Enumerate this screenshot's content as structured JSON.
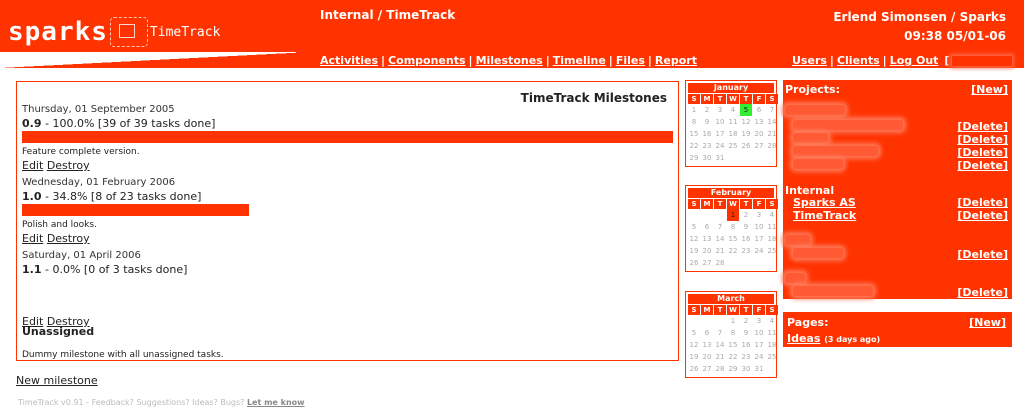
{
  "header": {
    "logo_word": "sparks",
    "logo_sub": "TimeTrack",
    "breadcrumb": "Internal / TimeTrack",
    "user": "Erlend Simonsen / Sparks",
    "clock": "09:38 05/01-06",
    "nav_left": [
      "Activities",
      "Components",
      "Milestones",
      "Timeline",
      "Files",
      "Report"
    ],
    "nav_right": [
      "Users",
      "Clients",
      "Log Out"
    ],
    "bracket_open": "["
  },
  "milestones": {
    "title": "TimeTrack Milestones",
    "items": [
      {
        "date": "Thursday, 01 September 2005",
        "version": "0.9",
        "stats": " - 100.0% [39 of 39 tasks done]",
        "progress": 1.0,
        "desc": "Feature complete version.",
        "edit": "Edit",
        "destroy": "Destroy"
      },
      {
        "date": "Wednesday, 01 February 2006",
        "version": "1.0",
        "stats": " - 34.8% [8 of 23 tasks done]",
        "progress": 0.348,
        "desc": "Polish and looks.",
        "edit": "Edit",
        "destroy": "Destroy"
      },
      {
        "date": "Saturday, 01 April 2006",
        "version": "1.1",
        "stats": " - 0.0% [0 of 3 tasks done]",
        "progress": 0.0,
        "desc": "",
        "edit": "Edit",
        "destroy": "Destroy"
      }
    ],
    "unassigned": "Unassigned",
    "unassigned_desc": "Dummy milestone with all unassigned tasks.",
    "new_link": "New milestone"
  },
  "footer": {
    "text": "TimeTrack v0.91 - Feedback? Suggestions? Ideas? Bugs? ",
    "link": "Let me know"
  },
  "calendars": {
    "day_headers": [
      "S",
      "M",
      "T",
      "W",
      "T",
      "F",
      "S"
    ],
    "months": [
      {
        "name": "January",
        "lead": 0,
        "days": 31,
        "today": 5,
        "mark": null
      },
      {
        "name": "February",
        "lead": 3,
        "days": 28,
        "today": null,
        "mark": 1
      },
      {
        "name": "March",
        "lead": 3,
        "days": 31,
        "today": null,
        "mark": null
      }
    ]
  },
  "projects": {
    "header": "Projects:",
    "new_label": "[New]",
    "delete_label": "[Delete]",
    "group_internal": "Internal",
    "internal_items": [
      "Sparks AS",
      "TimeTrack"
    ]
  },
  "pages": {
    "header": "Pages:",
    "new_label": "[New]",
    "item": "Ideas",
    "item_meta": "(3 days ago)"
  },
  "colors": {
    "accent": "#ff3300",
    "today": "#33ee33"
  }
}
